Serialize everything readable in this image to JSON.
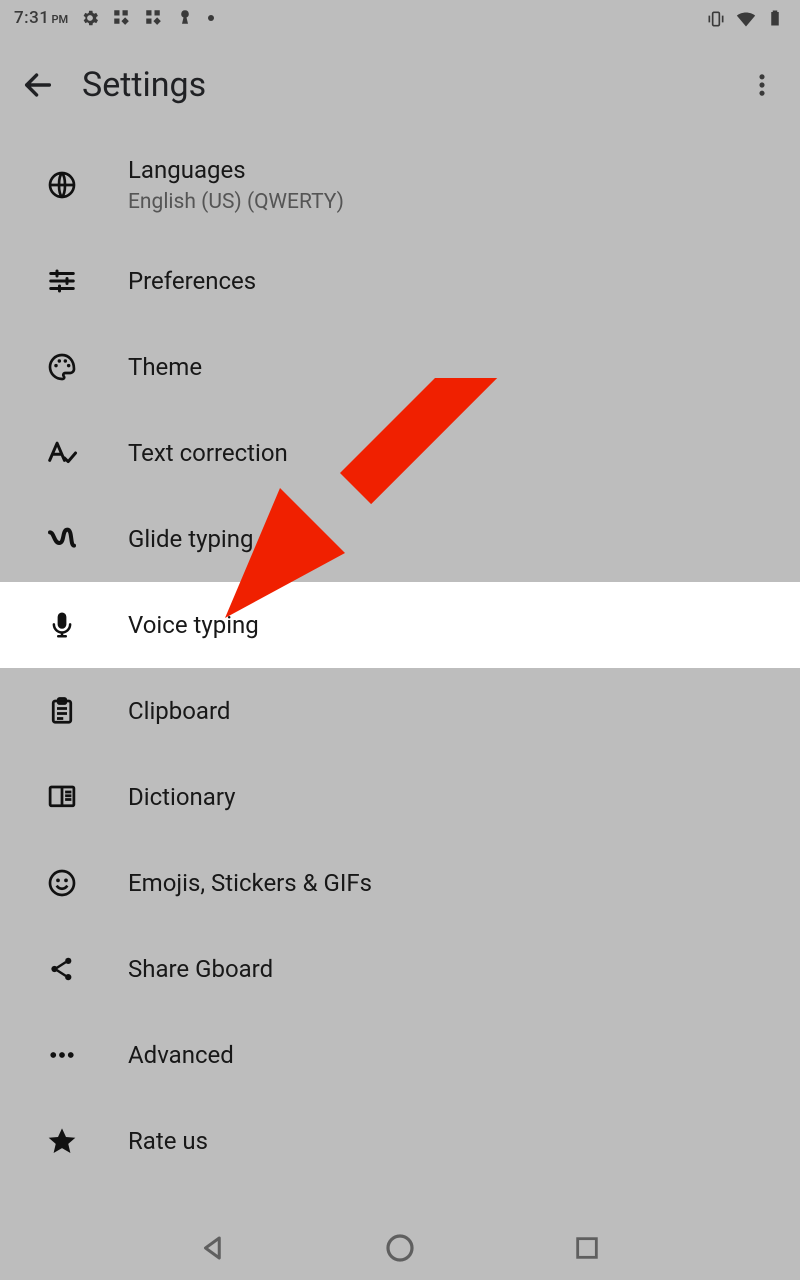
{
  "status": {
    "time": "7:31",
    "ampm": "PM"
  },
  "appbar": {
    "title": "Settings"
  },
  "items": [
    {
      "icon": "globe-icon",
      "label": "Languages",
      "sub": "English (US) (QWERTY)"
    },
    {
      "icon": "sliders-icon",
      "label": "Preferences"
    },
    {
      "icon": "palette-icon",
      "label": "Theme"
    },
    {
      "icon": "text-correct-icon",
      "label": "Text correction"
    },
    {
      "icon": "glide-icon",
      "label": "Glide typing"
    },
    {
      "icon": "mic-icon",
      "label": "Voice typing",
      "highlight": true
    },
    {
      "icon": "clipboard-icon",
      "label": "Clipboard"
    },
    {
      "icon": "dictionary-icon",
      "label": "Dictionary"
    },
    {
      "icon": "emoji-icon",
      "label": "Emojis, Stickers & GIFs"
    },
    {
      "icon": "share-icon",
      "label": "Share Gboard"
    },
    {
      "icon": "more-icon",
      "label": "Advanced"
    },
    {
      "icon": "star-icon",
      "label": "Rate us"
    }
  ],
  "annotation": {
    "color": "#F02000"
  }
}
